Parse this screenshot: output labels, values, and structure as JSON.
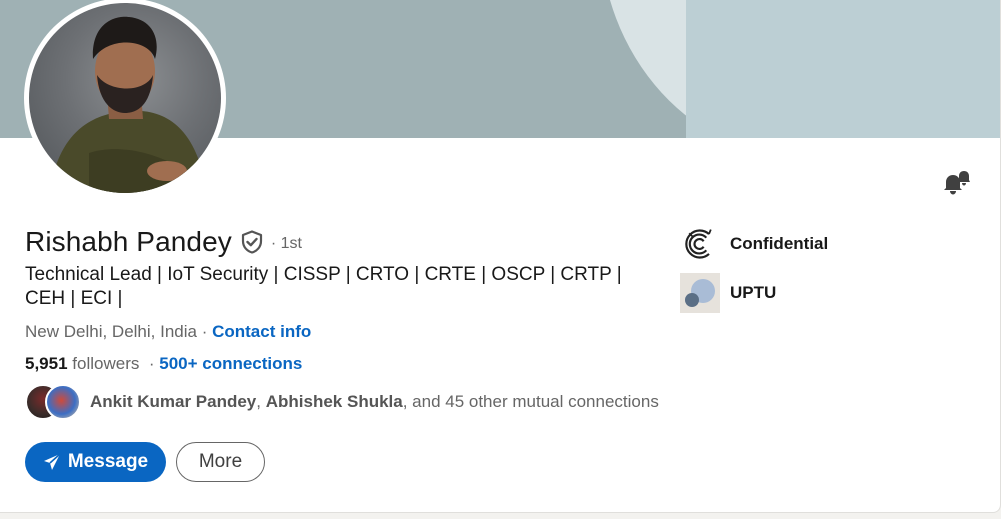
{
  "profile": {
    "name": "Rishabh Pandey",
    "degree": "· 1st",
    "headline": "Technical Lead | IoT Security | CISSP | CRTO | CRTE | OSCP | CRTP | CEH | ECI |",
    "location": "New Delhi, Delhi, India ·",
    "contact_info": "Contact info",
    "followers_count": "5,951",
    "followers_label": "followers",
    "separator": "·",
    "connections": "500+ connections",
    "mutual": {
      "name1": "Ankit Kumar Pandey",
      "comma": ",",
      "name2": "Abhishek Shukla",
      "rest": ", and 45 other mutual connections"
    }
  },
  "actions": {
    "message_label": "Message",
    "more_label": "More"
  },
  "organizations": [
    {
      "name": "Confidential",
      "icon": "confidential-logo"
    },
    {
      "name": "UPTU",
      "icon": "uptu-logo"
    }
  ],
  "icons": {
    "notify": "bell-icon",
    "verified": "verified-shield-icon",
    "send": "send-icon"
  },
  "colors": {
    "accent": "#0a66c2",
    "banner": "#9fb1b4"
  }
}
